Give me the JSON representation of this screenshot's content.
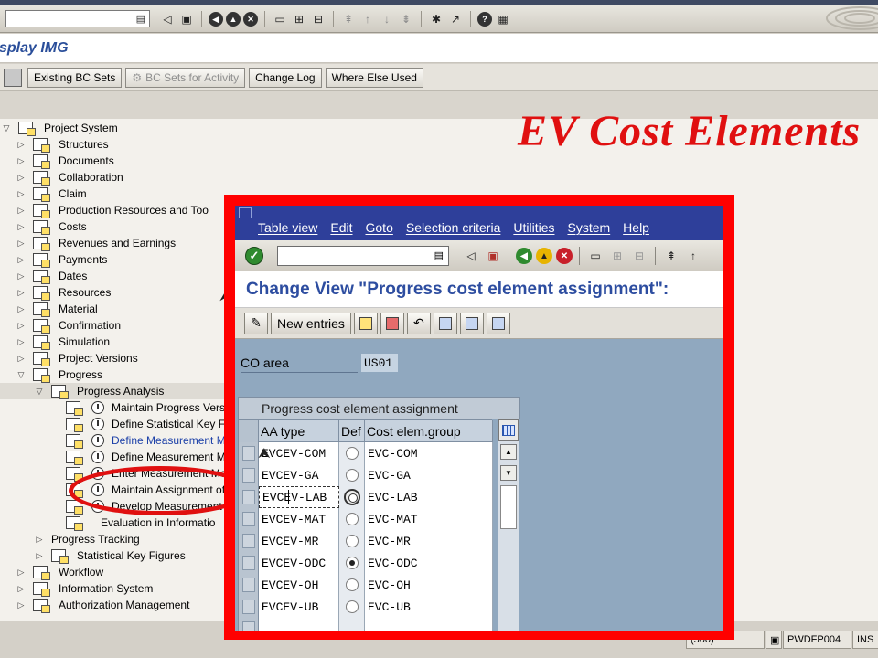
{
  "outer": {
    "screen_title": "splay IMG",
    "app_toolbar": {
      "existing_bc_sets": "Existing BC Sets",
      "bc_sets_for_activity": "BC Sets for Activity",
      "change_log": "Change Log",
      "where_else_used": "Where Else Used"
    },
    "tree": [
      {
        "label": "Project System",
        "level": 0,
        "expander": "down",
        "icon": "doc"
      },
      {
        "label": "Structures",
        "level": 1,
        "expander": "right",
        "icon": "doc"
      },
      {
        "label": "Documents",
        "level": 1,
        "expander": "right",
        "icon": "doc"
      },
      {
        "label": "Collaboration",
        "level": 1,
        "expander": "right",
        "icon": "doc"
      },
      {
        "label": "Claim",
        "level": 1,
        "expander": "right",
        "icon": "doc"
      },
      {
        "label": "Production Resources and Too",
        "level": 1,
        "expander": "right",
        "icon": "doc"
      },
      {
        "label": "Costs",
        "level": 1,
        "expander": "right",
        "icon": "doc"
      },
      {
        "label": "Revenues and Earnings",
        "level": 1,
        "expander": "right",
        "icon": "doc"
      },
      {
        "label": "Payments",
        "level": 1,
        "expander": "right",
        "icon": "doc"
      },
      {
        "label": "Dates",
        "level": 1,
        "expander": "right",
        "icon": "doc"
      },
      {
        "label": "Resources",
        "level": 1,
        "expander": "right",
        "icon": "doc"
      },
      {
        "label": "Material",
        "level": 1,
        "expander": "right",
        "icon": "doc"
      },
      {
        "label": "Confirmation",
        "level": 1,
        "expander": "right",
        "icon": "doc"
      },
      {
        "label": "Simulation",
        "level": 1,
        "expander": "right",
        "icon": "doc"
      },
      {
        "label": "Project Versions",
        "level": 1,
        "expander": "right",
        "icon": "doc"
      },
      {
        "label": "Progress",
        "level": 1,
        "expander": "down",
        "icon": "doc"
      },
      {
        "label": "Progress Analysis",
        "level": 2,
        "expander": "down",
        "icon": "doc",
        "highlight": true
      },
      {
        "label": "Maintain Progress Vers",
        "level": 3,
        "expander": "",
        "icon": "activity"
      },
      {
        "label": "Define Statistical Key F",
        "level": 3,
        "expander": "",
        "icon": "activity"
      },
      {
        "label": "Define Measurement M",
        "level": 3,
        "expander": "",
        "icon": "activity",
        "link": true
      },
      {
        "label": "Define Measurement M",
        "level": 3,
        "expander": "",
        "icon": "activity"
      },
      {
        "label": "Enter Measurement Me",
        "level": 3,
        "expander": "",
        "icon": "activity"
      },
      {
        "label": "Maintain Assignment of",
        "level": 3,
        "expander": "",
        "icon": "activity"
      },
      {
        "label": "Develop Measurement",
        "level": 3,
        "expander": "",
        "icon": "activity"
      },
      {
        "label": "Evaluation in Informatio",
        "level": 3,
        "expander": "",
        "icon": "doc-only"
      },
      {
        "label": "Progress Tracking",
        "level": 2,
        "expander": "right",
        "icon": "none"
      },
      {
        "label": "Statistical Key Figures",
        "level": 2,
        "expander": "right",
        "icon": "doc"
      },
      {
        "label": "Workflow",
        "level": 1,
        "expander": "right",
        "icon": "doc"
      },
      {
        "label": "Information System",
        "level": 1,
        "expander": "right",
        "icon": "doc"
      },
      {
        "label": "Authorization Management",
        "level": 1,
        "expander": "right",
        "icon": "doc"
      }
    ],
    "status": {
      "session": "(500)",
      "server": "PWDFP004",
      "mode": "INS"
    }
  },
  "annotation": {
    "title": "EV Cost Elements",
    "color": "#e01010"
  },
  "popup": {
    "menu": [
      "Table view",
      "Edit",
      "Goto",
      "Selection criteria",
      "Utilities",
      "System",
      "Help"
    ],
    "title": "Change View \"Progress cost element assignment\":",
    "new_entries": "New entries",
    "co_area_label": "CO area",
    "co_area_value": "US01",
    "group_title": "Progress cost element assignment",
    "columns": {
      "aa_type": "AA type",
      "def": "Def",
      "cost_group": "Cost elem.group"
    },
    "rows": [
      {
        "aa_type": "EVCEV-COM",
        "def": "off",
        "cost_group": "EVC-COM"
      },
      {
        "aa_type": "EVCEV-GA",
        "def": "off",
        "cost_group": "EVC-GA"
      },
      {
        "aa_type": "EVCEV-LAB",
        "def": "focus",
        "cost_group": "EVC-LAB"
      },
      {
        "aa_type": "EVCEV-MAT",
        "def": "off",
        "cost_group": "EVC-MAT"
      },
      {
        "aa_type": "EVCEV-MR",
        "def": "off",
        "cost_group": "EVC-MR"
      },
      {
        "aa_type": "EVCEV-ODC",
        "def": "on",
        "cost_group": "EVC-ODC"
      },
      {
        "aa_type": "EVCEV-OH",
        "def": "off",
        "cost_group": "EVC-OH"
      },
      {
        "aa_type": "EVCEV-UB",
        "def": "off",
        "cost_group": "EVC-UB"
      },
      {
        "aa_type": "",
        "def": "",
        "cost_group": ""
      }
    ]
  }
}
